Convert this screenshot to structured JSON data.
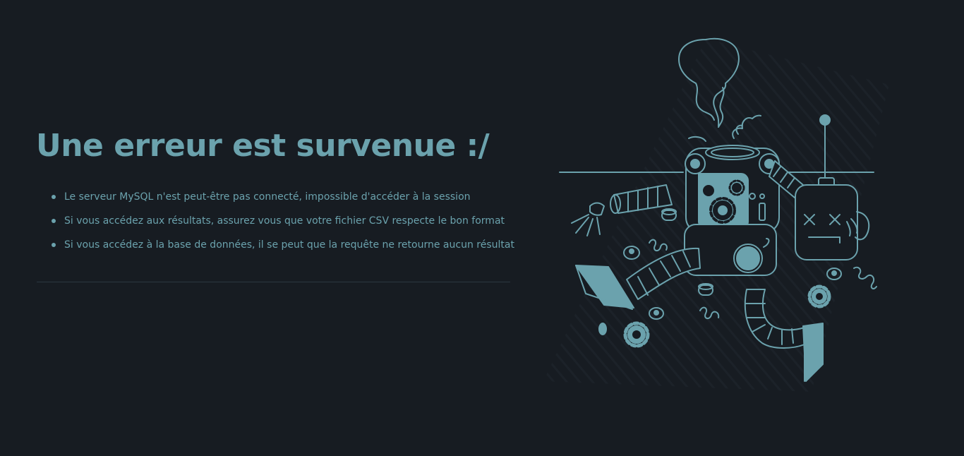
{
  "error": {
    "title": "Une erreur est survenue :/",
    "messages": [
      "Le serveur MySQL n'est peut-être pas connecté, impossible d'accéder à la session",
      "Si vous accédez aux résultats, assurez vous que votre fichier CSV respecte le bon format",
      "Si vous accédez à la base de données, il se peut que la requête ne retourne aucun résultat"
    ]
  },
  "illustration": {
    "icon": "broken-robot-illustration"
  },
  "colors": {
    "background": "#171c22",
    "accent": "#6ba2ad",
    "divider": "#2c3740"
  }
}
